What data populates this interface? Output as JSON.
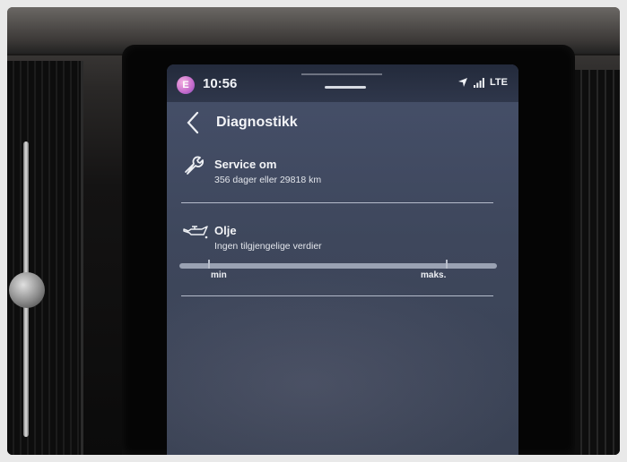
{
  "statusbar": {
    "avatar_letter": "E",
    "time": "10:56",
    "network": "LTE",
    "icons": [
      "location-arrow-icon",
      "signal-bars-icon"
    ]
  },
  "header": {
    "title": "Diagnostikk",
    "back_icon": "chevron-left-icon"
  },
  "service": {
    "icon": "wrench-icon",
    "label": "Service om",
    "detail": "356 dager eller 29818 km"
  },
  "oil": {
    "icon": "oil-can-icon",
    "label": "Olje",
    "detail": "Ingen tilgjengelige verdier",
    "gauge_min_label": "min",
    "gauge_max_label": "maks."
  },
  "colors": {
    "screen_bg": "#3e475c",
    "text": "#f3f4f7",
    "divider": "#b5bccb"
  }
}
